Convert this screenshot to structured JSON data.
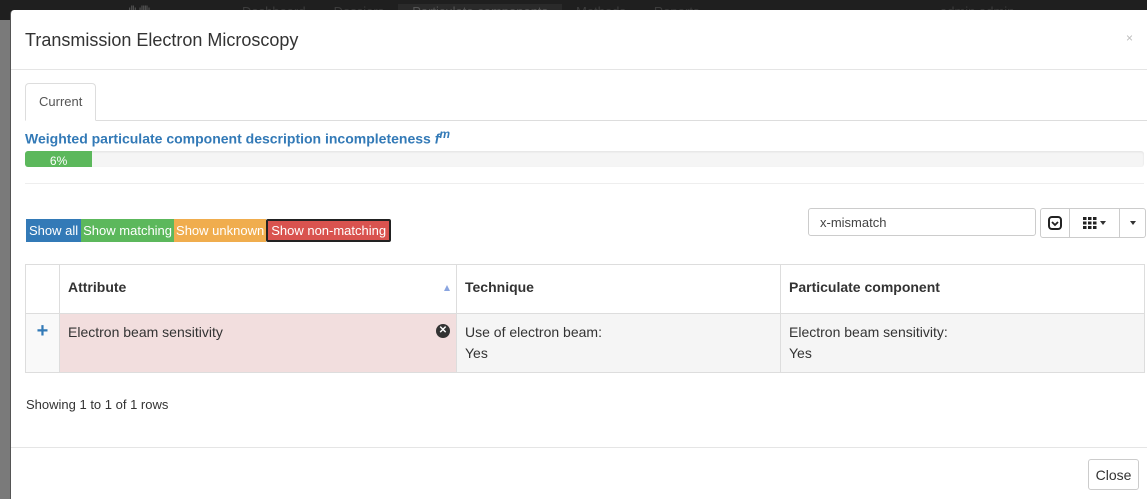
{
  "navbar": {
    "brand": "ıllı ıllllı.",
    "items": [
      "Dashboard",
      "Dossiers",
      "Particulate components",
      "Methods",
      "Reports"
    ],
    "active_index": 2,
    "user": "admin admin"
  },
  "modal": {
    "title": "Transmission Electron Microscopy",
    "close_x": "×",
    "tabs": [
      {
        "label": "Current"
      }
    ],
    "incompleteness": {
      "label": "Weighted particulate component description incompleteness",
      "symbol": "f",
      "superscript": "m",
      "percent_text": "6%",
      "percent_value": 6,
      "bar_color": "#5cb85c"
    },
    "filters": {
      "show_all": "Show all",
      "show_matching": "Show matching",
      "show_unknown": "Show unknown",
      "show_non_matching": "Show non-matching",
      "colors": {
        "all": "#337ab7",
        "matching": "#5cb85c",
        "unknown": "#f0ad4e",
        "non_matching": "#d9534f"
      }
    },
    "search": {
      "value": "x-mismatch"
    },
    "table": {
      "headers": {
        "attribute": "Attribute",
        "technique": "Technique",
        "particulate_component": "Particulate component"
      },
      "rows": [
        {
          "attribute": "Electron beam sensitivity",
          "technique_label": "Use of electron beam:",
          "technique_value": "Yes",
          "component_label": "Electron beam sensitivity:",
          "component_value": "Yes",
          "status": "non-matching",
          "row_color": "#f2dede"
        }
      ]
    },
    "pagination": "Showing 1 to 1 of 1 rows",
    "close_button": "Close"
  }
}
